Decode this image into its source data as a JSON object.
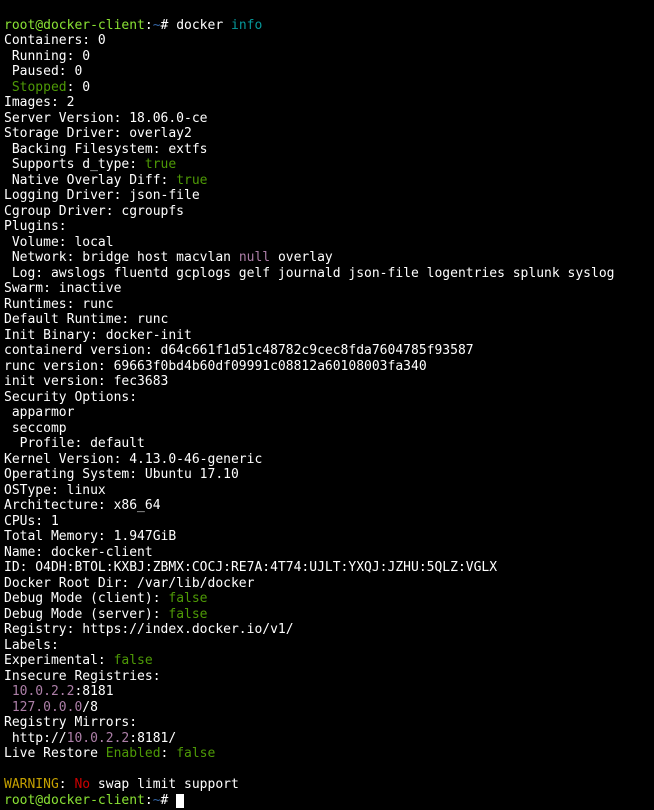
{
  "prompt": {
    "user": "root@docker-client",
    "sep": ":",
    "path": "~",
    "hash": "#",
    "cmd": "docker",
    "arg": "info"
  },
  "info": {
    "containers": "Containers: 0",
    "running": " Running: 0",
    "paused": " Paused: 0",
    "stopped_lbl": " Stopped",
    "stopped_val": ": 0",
    "images": "Images: 2",
    "server_ver": "Server Version: 18.06.0-ce",
    "storage": "Storage Driver: overlay2",
    "backing_fs": " Backing Filesystem: extfs",
    "dtype_lbl": " Supports d_type: ",
    "dtype_val": "true",
    "native_lbl": " Native Overlay Diff: ",
    "native_val": "true",
    "logging": "Logging Driver: json-file",
    "cgroup": "Cgroup Driver: cgroupfs",
    "plugins": "Plugins:",
    "vol": " Volume: local",
    "net_pre": " Network: bridge host macvlan ",
    "net_null": "null",
    "net_post": " overlay",
    "log": " Log: awslogs fluentd gcplogs gelf journald json-file logentries splunk syslog",
    "swarm": "Swarm: inactive",
    "runtimes": "Runtimes: runc",
    "def_rt": "Default Runtime: runc",
    "init_bin": "Init Binary: docker-init",
    "containerd": "containerd version: d64c661f1d51c48782c9cec8fda7604785f93587",
    "runc": "runc version: 69663f0bd4b60df09991c08812a60108003fa340",
    "init_ver": "init version: fec3683",
    "sec_opts": "Security Options:",
    "apparmor": " apparmor",
    "seccomp": " seccomp",
    "profile": "  Profile: default",
    "kernel": "Kernel Version: 4.13.0-46-generic",
    "os": "Operating System: Ubuntu 17.10",
    "ostype": "OSType: linux",
    "arch": "Architecture: x86_64",
    "cpus": "CPUs: 1",
    "mem": "Total Memory: 1.947GiB",
    "name": "Name: docker-client",
    "id": "ID: O4DH:BTOL:KXBJ:ZBMX:COCJ:RE7A:4T74:UJLT:YXQJ:JZHU:5QLZ:VGLX",
    "rootdir": "Docker Root Dir: /var/lib/docker",
    "dbg_c_lbl": "Debug Mode (client): ",
    "dbg_c_val": "false",
    "dbg_s_lbl": "Debug Mode (server): ",
    "dbg_s_val": "false",
    "registry": "Registry: https://index.docker.io/v1/",
    "labels": "Labels:",
    "exp_lbl": "Experimental: ",
    "exp_val": "false",
    "insec": "Insecure Registries:",
    "insec_ip": " 10.0.2.2",
    "insec_port": ":8181",
    "loopback": " 127.0.0.0",
    "loopback_m": "/8",
    "mirrors": "Registry Mirrors:",
    "mir_pre": " http://",
    "mir_ip": "10.0.2.2",
    "mir_post": ":8181/",
    "live_pre": "Live Restore ",
    "live_en": "Enabled",
    "live_sep": ": ",
    "live_val": "false"
  },
  "warn": {
    "label": "WARNING",
    "sep": ": ",
    "no": "No",
    "rest": " swap limit support"
  }
}
